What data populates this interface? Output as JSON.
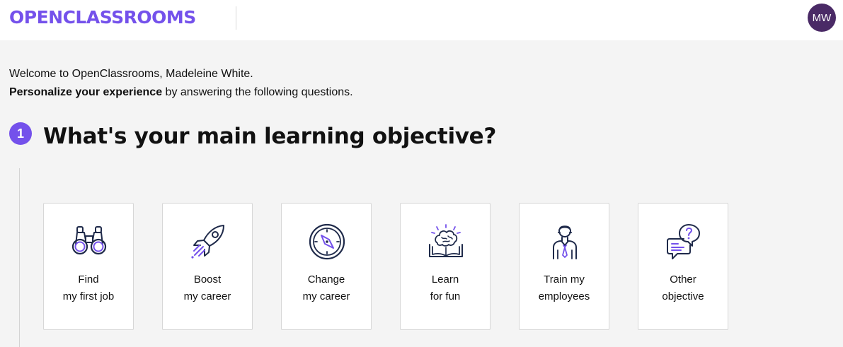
{
  "header": {
    "logo_text": "OPENCLASSROOMS",
    "avatar_initials": "MW"
  },
  "intro": {
    "welcome_line": "Welcome to OpenClassrooms, Madeleine White.",
    "personalize_bold": "Personalize your experience",
    "personalize_rest": " by answering the following questions."
  },
  "question": {
    "step_number": "1",
    "title": "What's your main learning objective?"
  },
  "options": [
    {
      "line1": "Find ",
      "line2": "my first job",
      "icon": "binoculars-icon"
    },
    {
      "line1": "Boost ",
      "line2": "my career",
      "icon": "rocket-icon"
    },
    {
      "line1": "Change ",
      "line2": "my career",
      "icon": "compass-icon"
    },
    {
      "line1": "Learn",
      "line2": "for fun",
      "icon": "brain-book-icon"
    },
    {
      "line1": "Train my",
      "line2": "employees",
      "icon": "employee-icon"
    },
    {
      "line1": "Other",
      "line2": "objective",
      "icon": "question-bubbles-icon"
    }
  ],
  "colors": {
    "brand": "#7451eb",
    "icon_dark": "#1f2a4a",
    "avatar_bg": "#4a2a66",
    "page_bg": "#f4f4f4"
  }
}
